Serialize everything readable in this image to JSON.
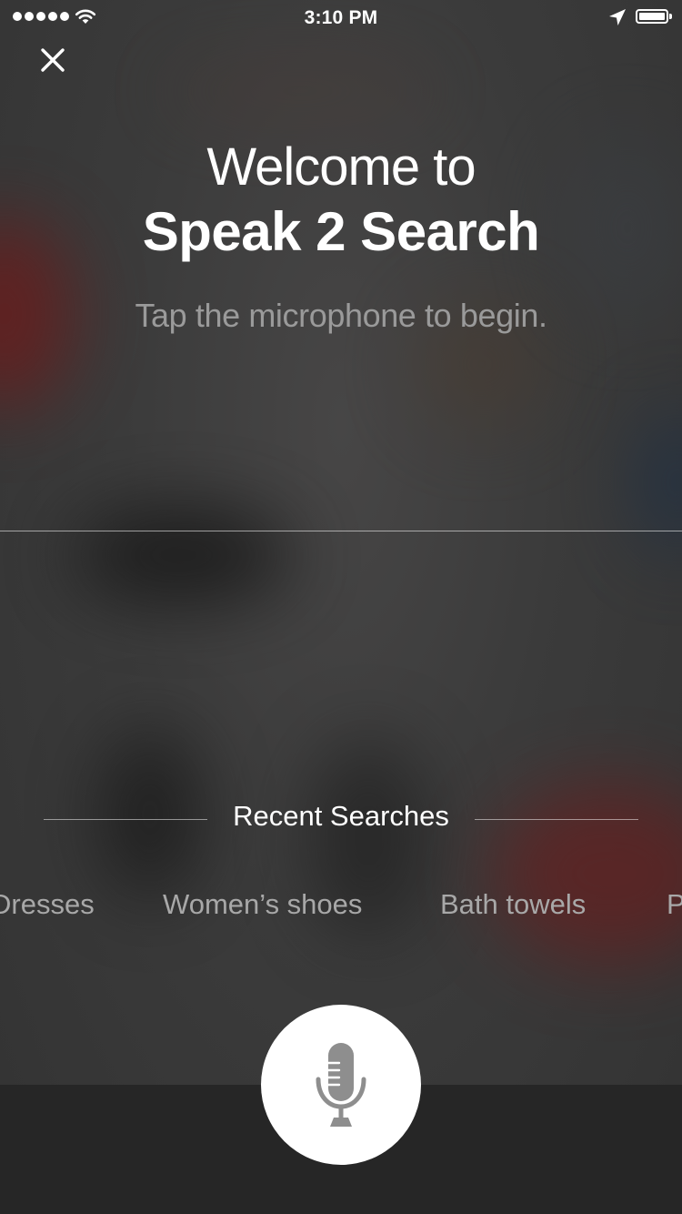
{
  "status_bar": {
    "time": "3:10 PM",
    "signal_dots": 5,
    "battery_level": 1.0,
    "icons": [
      "signal-dots-icon",
      "wifi-icon",
      "location-arrow-icon",
      "battery-icon"
    ]
  },
  "header": {
    "close_icon": "close-icon"
  },
  "welcome": {
    "line1": "Welcome to",
    "line2": "Speak 2 Search",
    "subtitle": "Tap the microphone to begin."
  },
  "recent": {
    "title": "Recent Searches",
    "items": [
      {
        "label": "Dresses"
      },
      {
        "label": "Women’s shoes"
      },
      {
        "label": "Bath towels"
      },
      {
        "label": "P"
      }
    ]
  },
  "mic": {
    "icon": "microphone-icon"
  },
  "colors": {
    "text_primary": "#ffffff",
    "text_muted": "#9a9a9a",
    "mic_button_bg": "#ffffff",
    "mic_icon": "#8e8e8e",
    "bottom_bar": "#262626"
  }
}
